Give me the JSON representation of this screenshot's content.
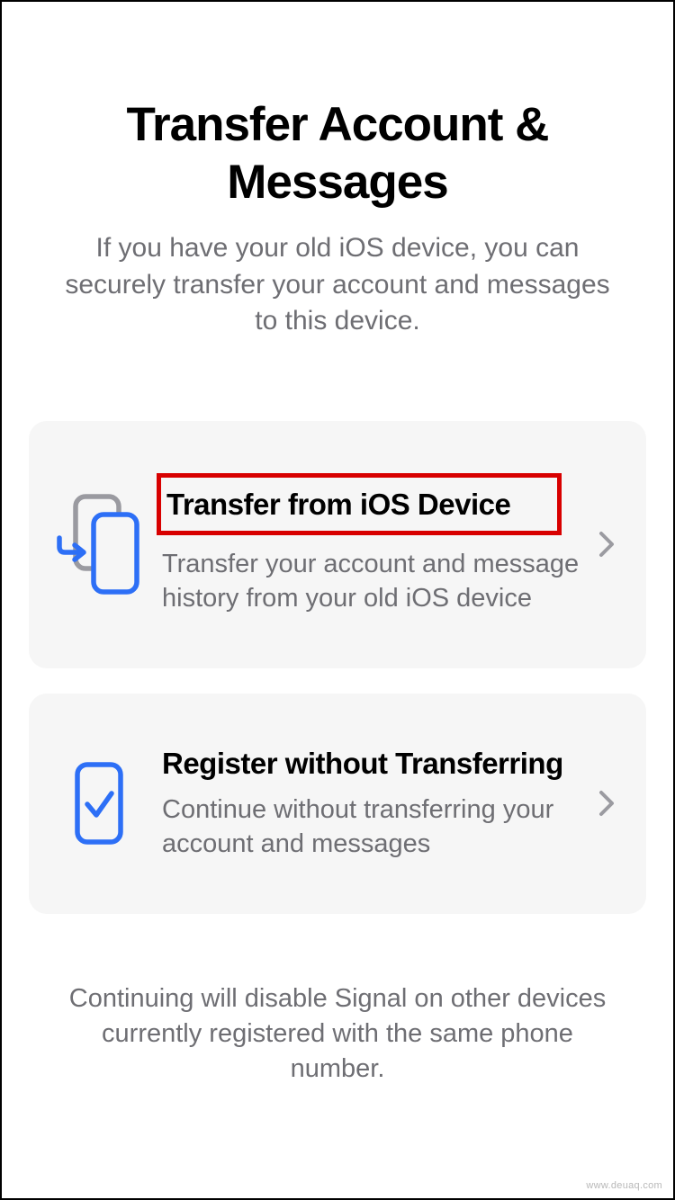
{
  "header": {
    "title": "Transfer Account & Messages",
    "subtitle": "If you have your old iOS device, you can securely transfer your account and messages to this device."
  },
  "options": {
    "transfer": {
      "title": "Transfer from iOS Device",
      "description": "Transfer your account and message history from your old iOS device"
    },
    "register": {
      "title": "Register without Transferring",
      "description": "Continue without transferring your account and messages"
    }
  },
  "footer": {
    "note": "Continuing will disable Signal on other devices currently registered with the same phone number."
  },
  "watermark": "www.deuaq.com"
}
